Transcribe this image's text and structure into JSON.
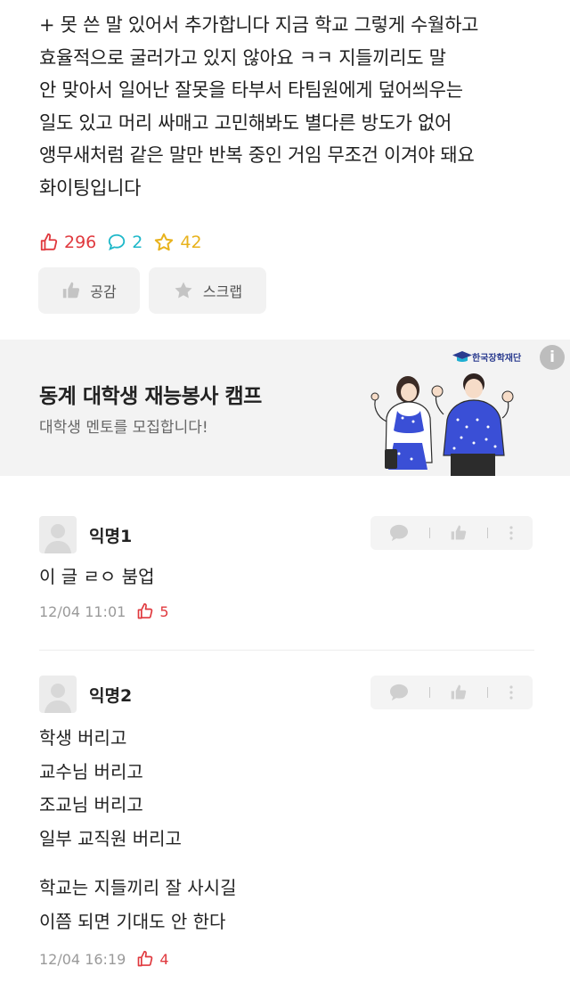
{
  "post": {
    "body_lines": [
      "+ 못 쓴 말 있어서 추가합니다 지금 학교 그렇게 수월하고",
      "효율적으로 굴러가고 있지 않아요 ㅋㅋ 지들끼리도 말",
      "안 맞아서 일어난 잘못을 타부서 타팀원에게 덮어씌우는",
      "일도 있고 머리 싸매고 고민해봐도 별다른 방도가 없어",
      "앵무새처럼 같은 말만 반복 중인 거임 무조건 이겨야 돼요",
      "화이팅입니다"
    ],
    "stats": {
      "likes": "296",
      "comments": "2",
      "scraps": "42"
    },
    "actions": {
      "like_label": "공감",
      "scrap_label": "스크랩"
    }
  },
  "ad": {
    "title": "동계 대학생 재능봉사 캠프",
    "subtitle": "대학생 멘토를 모집합니다!",
    "logo_text": "한국장학재단",
    "info_icon": "i",
    "colors": {
      "bg": "#f3f3f3",
      "accent": "#3a4fd6"
    }
  },
  "comments": [
    {
      "author": "익명1",
      "lines": [
        "이 글 ㄹㅇ 붐업"
      ],
      "time": "12/04 11:01",
      "likes": "5"
    },
    {
      "author": "익명2",
      "lines": [
        "학생 버리고",
        "교수님 버리고",
        "조교님 버리고",
        "일부 교직원 버리고",
        "",
        "학교는 지들끼리 잘 사시길",
        "이쯤 되면 기대도 안 한다"
      ],
      "time": "12/04 16:19",
      "likes": "4"
    }
  ],
  "colors": {
    "like": "#e0393e",
    "comment": "#1eb8c9",
    "scrap": "#e8b21c"
  },
  "icons": [
    "thumbs-up-icon",
    "speech-bubble-icon",
    "star-icon",
    "more-vert-icon",
    "info-icon"
  ]
}
